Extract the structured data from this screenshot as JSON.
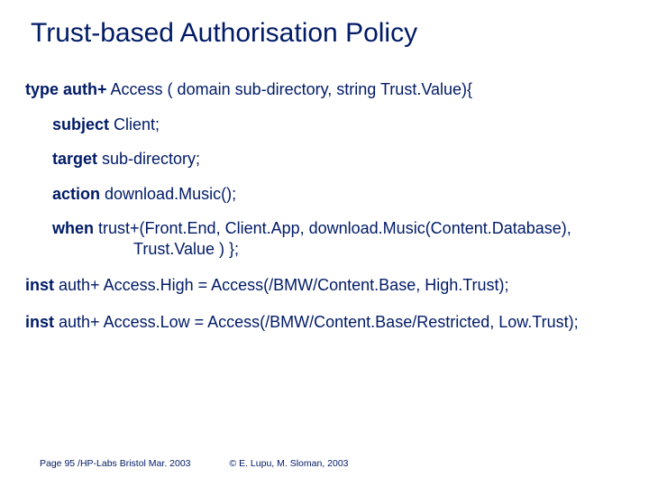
{
  "title": "Trust-based Authorisation Policy",
  "code": {
    "l1_b": "type auth+",
    "l1_r": " Access ( domain sub-directory, string Trust.Value){",
    "l2_b": "subject",
    "l2_r": " Client;",
    "l3_b": "target",
    "l3_r": " sub-directory;",
    "l4_b": "action",
    "l4_r": " download.Music();",
    "l5_b": "when",
    "l5_r": " trust+(Front.End, Client.App,  download.Music(Content.Database),",
    "l5c": "Trust.Value ) };",
    "l6_b": "inst",
    "l6_r": " auth+ Access.High =  Access(/BMW/Content.Base, High.Trust);",
    "l7_b": "inst",
    "l7_r": " auth+ Access.Low = Access(/BMW/Content.Base/Restricted, Low.Trust);"
  },
  "footer": {
    "left": "Page 95 /HP-Labs Bristol Mar. 2003",
    "right": "© E. Lupu, M. Sloman, 2003"
  }
}
